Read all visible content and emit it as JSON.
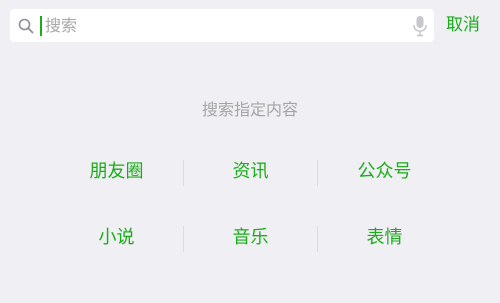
{
  "search": {
    "placeholder": "搜索",
    "value": "",
    "search_icon": "search-icon",
    "mic_icon": "microphone-icon"
  },
  "header": {
    "cancel_label": "取消"
  },
  "hint": {
    "title": "搜索指定内容"
  },
  "categories": [
    [
      "朋友圈",
      "资讯",
      "公众号"
    ],
    [
      "小说",
      "音乐",
      "表情"
    ]
  ],
  "colors": {
    "accent": "#1aad19",
    "background": "#efeff4",
    "hint_text": "#a5a5a5"
  }
}
